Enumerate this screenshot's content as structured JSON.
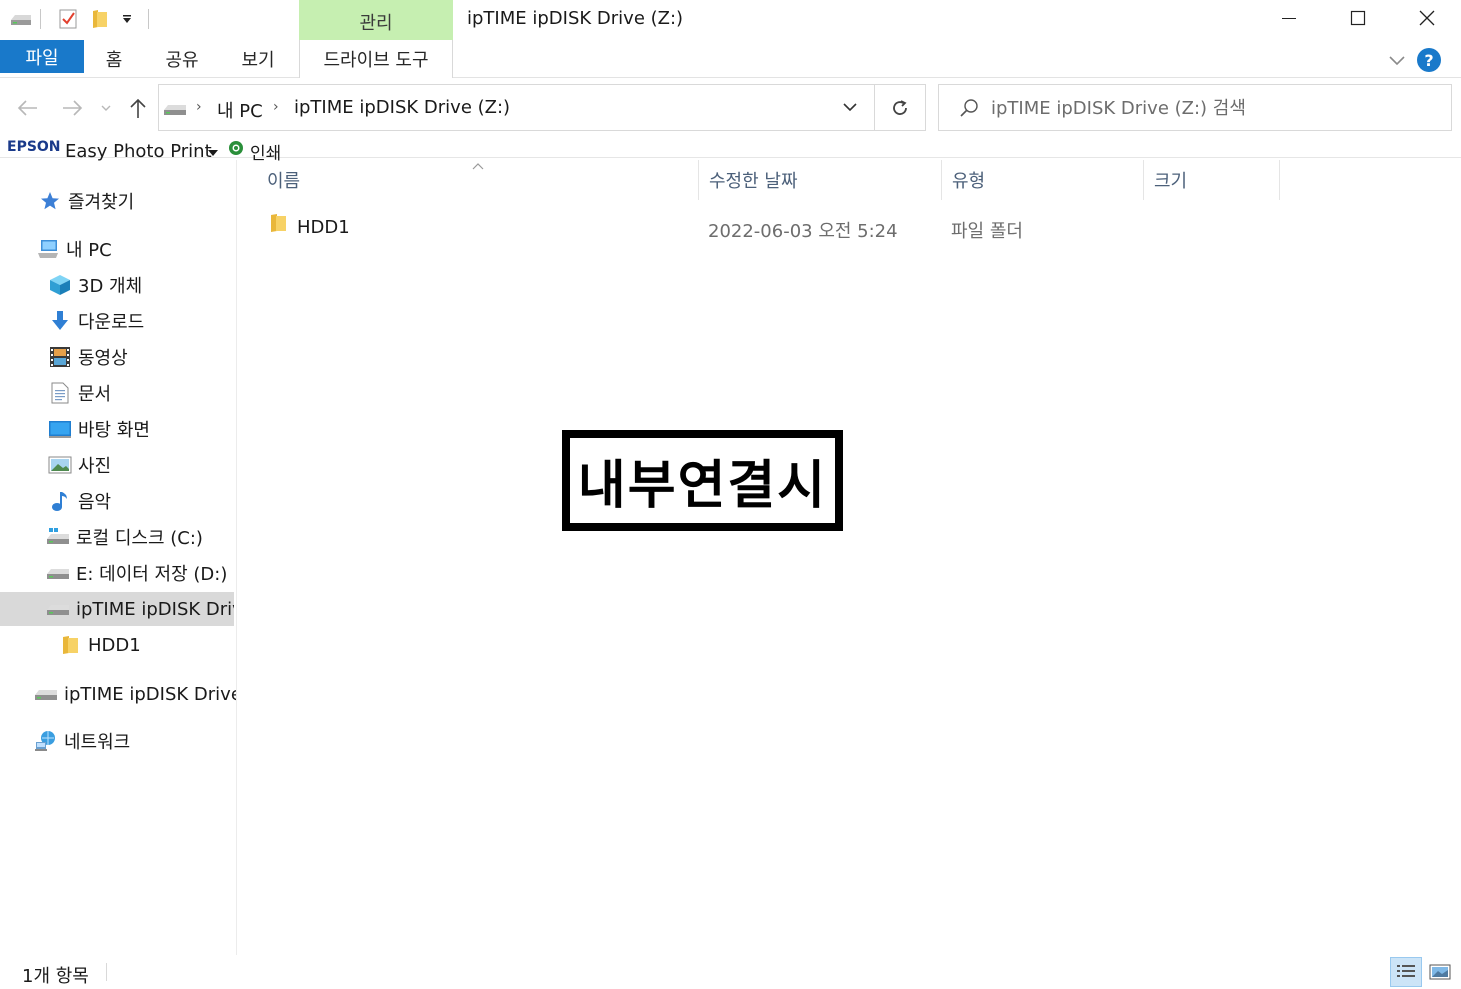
{
  "titlebar": {
    "context_tab": "관리",
    "window_title": "ipTIME ipDISK Drive (Z:)"
  },
  "ribbon": {
    "tabs": {
      "file": "파일",
      "home": "홈",
      "share": "공유",
      "view": "보기",
      "drive_tools": "드라이브 도구"
    },
    "help_label": "?"
  },
  "address": {
    "crumbs": [
      "내 PC",
      "ipTIME ipDISK Drive (Z:)"
    ],
    "search_placeholder": "ipTIME ipDISK Drive (Z:) 검색"
  },
  "epson": {
    "brand": "EPSON",
    "app": "Easy Photo Print",
    "print": "인쇄"
  },
  "nav": {
    "favorites": "즐겨찾기",
    "this_pc": "내 PC",
    "objects3d": "3D 개체",
    "downloads": "다운로드",
    "videos": "동영상",
    "documents": "문서",
    "desktop": "바탕 화면",
    "pictures": "사진",
    "music": "음악",
    "local_c": "로컬 디스크 (C:)",
    "data_d": "E: 데이터 저장 (D:)",
    "iptime_z": "ipTIME ipDISK Drive (Z:)",
    "hdd1": "HDD1",
    "iptime_root": "ipTIME ipDISK Drive (Z:)",
    "network": "네트워크"
  },
  "columns": {
    "name": "이름",
    "modified": "수정한 날짜",
    "type": "유형",
    "size": "크기"
  },
  "files": [
    {
      "name": "HDD1",
      "modified": "2022-06-03 오전 5:24",
      "type": "파일 폴더",
      "size": ""
    }
  ],
  "overlay": {
    "text": "내부연결시"
  },
  "status": {
    "count": "1개 항목"
  },
  "colors": {
    "file_tab": "#1979ca",
    "context_tab": "#c6efb1",
    "selected_nav": "#d9d9d9",
    "column_header_text": "#4c607a",
    "folder": "#f5c84c"
  }
}
